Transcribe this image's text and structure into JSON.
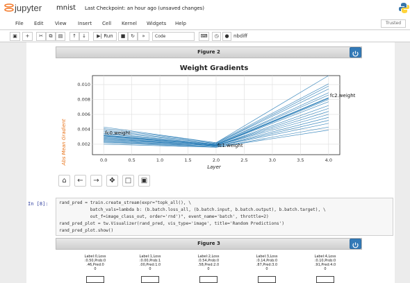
{
  "header": {
    "brand": "jupyter",
    "notebook_name": "mnist",
    "checkpoint": "Last Checkpoint: an hour ago  (unsaved changes)",
    "trusted": "Trusted"
  },
  "menu": [
    "File",
    "Edit",
    "View",
    "Insert",
    "Cell",
    "Kernel",
    "Widgets",
    "Help"
  ],
  "toolbar": {
    "run_label": "Run",
    "cell_type": "Code",
    "nbdiff_label": "nbdiff"
  },
  "figure2": {
    "bar_title": "Figure 2",
    "chart_data": {
      "type": "line",
      "title": "Weight Gradients",
      "xlabel": "Layer",
      "ylabel": "Abs Mean Gradient",
      "xticks": [
        "0.0",
        "0.5",
        "1.0",
        "1.5",
        "2.0",
        "2.5",
        "3.0",
        "3.5",
        "4.0"
      ],
      "yticks": [
        "0.002",
        "0.004",
        "0.006",
        "0.008",
        "0.010"
      ],
      "xlim": [
        -0.2,
        4.2
      ],
      "ylim": [
        0.0006,
        0.0112
      ],
      "grid": true,
      "annotations": [
        {
          "text": "fc0.weight",
          "x": 0.0,
          "y": 0.0035
        },
        {
          "text": "fc1.weight",
          "x": 2.0,
          "y": 0.0018
        },
        {
          "text": "fc2.weight",
          "x": 4.0,
          "y": 0.0085
        }
      ],
      "x": [
        0,
        2,
        4
      ],
      "series": [
        {
          "values": [
            0.0043,
            0.0022,
            0.0112
          ]
        },
        {
          "values": [
            0.0041,
            0.0022,
            0.0101
          ]
        },
        {
          "values": [
            0.0039,
            0.0021,
            0.0098
          ]
        },
        {
          "values": [
            0.0037,
            0.0021,
            0.0094
          ]
        },
        {
          "values": [
            0.0035,
            0.002,
            0.0089
          ]
        },
        {
          "values": [
            0.0034,
            0.002,
            0.0086
          ]
        },
        {
          "values": [
            0.0032,
            0.0019,
            0.0082
          ]
        },
        {
          "values": [
            0.0031,
            0.0019,
            0.008
          ]
        },
        {
          "values": [
            0.003,
            0.0019,
            0.0077
          ]
        },
        {
          "values": [
            0.0029,
            0.0018,
            0.0072
          ]
        },
        {
          "values": [
            0.0028,
            0.0018,
            0.0068
          ]
        },
        {
          "values": [
            0.0027,
            0.0018,
            0.0064
          ]
        },
        {
          "values": [
            0.0026,
            0.0018,
            0.006
          ]
        },
        {
          "values": [
            0.0025,
            0.0017,
            0.0056
          ]
        },
        {
          "values": [
            0.0024,
            0.0017,
            0.0052
          ]
        },
        {
          "values": [
            0.0023,
            0.0017,
            0.0048
          ]
        },
        {
          "values": [
            0.0022,
            0.0016,
            0.0043
          ]
        },
        {
          "values": [
            0.002,
            0.0016,
            0.0039
          ]
        }
      ],
      "series_color": "#1f77b4"
    }
  },
  "code_cell": {
    "prompt": "In [8]:",
    "lines": [
      "rand_pred = train.create_stream(expr=\"topk_all(), \\",
      "            batch_vals=lambda b: (b.batch.loss_all, (b.batch.input, b.batch.output), b.batch.target), \\",
      "            out_f=image_class_out, order='rnd')\", event_name='batch', throttle=2)",
      "rand_pred_plot = tw.Visualizer(rand_pred, vis_type='image', title='Random Predictions')",
      "rand_pred_plot.show()"
    ]
  },
  "figure3": {
    "bar_title": "Figure 3",
    "thumbs": [
      [
        "Label:0,Loss",
        ":0.50,Prob:0",
        ".46,Pred:0",
        "0"
      ],
      [
        "Label:1,Loss",
        ":0.00,Prob:1",
        ".00,Pred:1.0",
        "0"
      ],
      [
        "Label:2,Loss",
        ":0.54,Prob:0",
        ".58,Pred:2.0",
        "0"
      ],
      [
        "Label:3,Loss",
        ":0.14,Prob:0",
        ".87,Pred:3.0",
        "0"
      ],
      [
        "Label:4,Loss",
        ":0.10,Prob:0",
        ".91,Pred:4.0",
        "0"
      ]
    ]
  }
}
